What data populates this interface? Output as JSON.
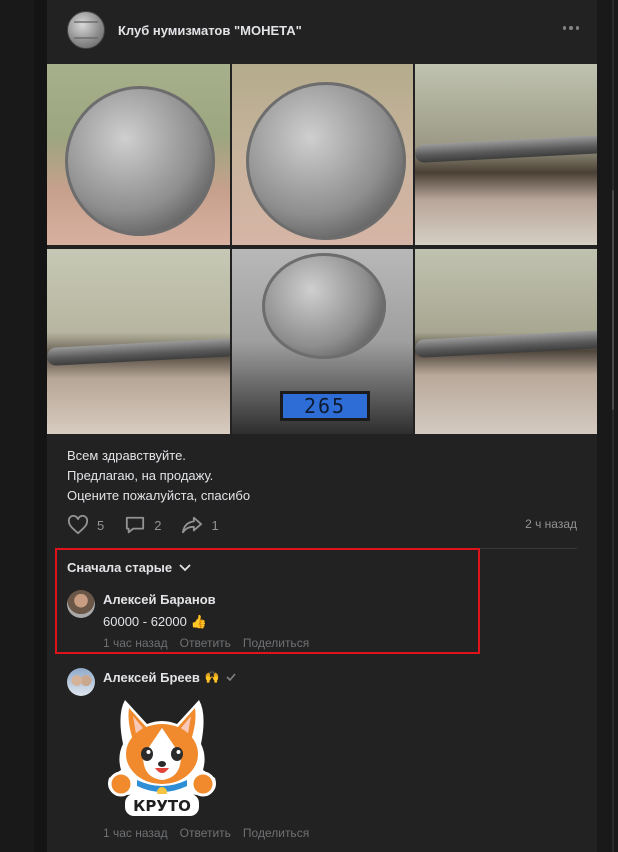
{
  "group": {
    "name": "Клуб нумизматов \"МОНЕТА\""
  },
  "photos": {
    "scale_reading": "265"
  },
  "post": {
    "lines": [
      "Всем здравствуйте.",
      "Предлагаю, на продажу.",
      "Оцените пожалуйста, спасибо"
    ],
    "likes": "5",
    "comments": "2",
    "shares": "1",
    "time": "2 ч назад"
  },
  "comments_section": {
    "sort_label": "Сначала старые",
    "items": [
      {
        "author": "Алексей Баранов",
        "text": "60000 - 62000 👍",
        "time": "1 час назад",
        "reply": "Ответить",
        "share": "Поделиться"
      },
      {
        "author": "Алексей Бреев",
        "badge": "🙌",
        "sticker_text": "КРУТО",
        "time": "1 час назад",
        "reply": "Ответить",
        "share": "Поделиться"
      }
    ]
  },
  "colors": {
    "highlight": "#e0121b",
    "background": "#141414",
    "card": "#222222"
  }
}
